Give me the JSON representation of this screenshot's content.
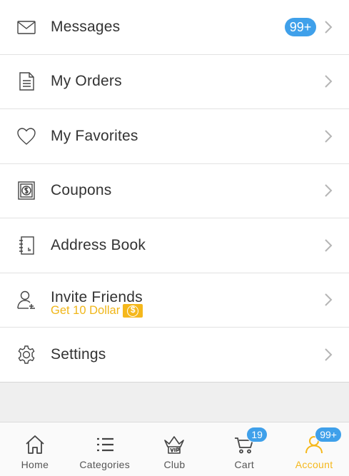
{
  "menu": {
    "items": [
      {
        "label": "Messages",
        "icon": "envelope-icon",
        "badge": "99+"
      },
      {
        "label": "My Orders",
        "icon": "document-icon"
      },
      {
        "label": "My Favorites",
        "icon": "heart-icon"
      },
      {
        "label": "Coupons",
        "icon": "coupon-icon"
      },
      {
        "label": "Address Book",
        "icon": "address-book-icon"
      },
      {
        "label": "Invite Friends",
        "icon": "invite-user-icon",
        "subtitle": "Get 10 Dollar",
        "subtitle_icon": "dollar-coin-icon"
      },
      {
        "label": "Settings",
        "icon": "gear-icon"
      }
    ]
  },
  "tabbar": {
    "tabs": [
      {
        "label": "Home",
        "icon": "home-icon"
      },
      {
        "label": "Categories",
        "icon": "list-icon"
      },
      {
        "label": "Club",
        "icon": "vip-crown-icon"
      },
      {
        "label": "Cart",
        "icon": "cart-icon",
        "badge": "19"
      },
      {
        "label": "Account",
        "icon": "user-icon",
        "badge": "99+",
        "active": true
      }
    ]
  },
  "colors": {
    "accent": "#f5b81c",
    "badge": "#3fa0ea",
    "text": "#333333",
    "background": "#efefef"
  }
}
